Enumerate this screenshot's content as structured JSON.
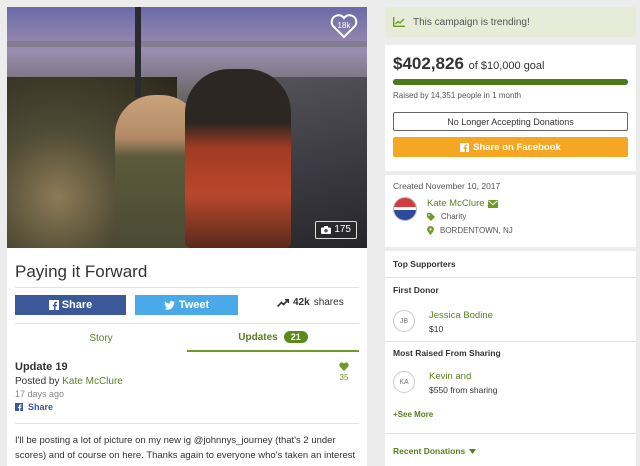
{
  "campaign": {
    "title": "Paying it Forward",
    "photo_count": "175",
    "like_count": "18k"
  },
  "share": {
    "facebook_label": "Share",
    "twitter_label": "Tweet",
    "shares_count": "42k",
    "shares_suffix": "shares"
  },
  "tabs": {
    "story_label": "Story",
    "updates_label": "Updates",
    "updates_count": "21"
  },
  "update": {
    "title": "Update 19",
    "posted_by_prefix": "Posted by",
    "author": "Kate McClure",
    "ago": "17 days ago",
    "share_label": "Share",
    "heart_count": "35",
    "text": "I'll be posting a lot of picture on my new ig @johnnys_journey (that's 2 under scores) and of course on here. Thanks again to everyone who's taken an interest in me!!"
  },
  "sidebar": {
    "trending_text": "This campaign is trending!",
    "raised_amount": "$402,826",
    "goal_text": "of $10,000 goal",
    "progress_fraction": 1.0,
    "raised_meta": "Raised by 14,351 people in 1 month",
    "no_longer_label": "No Longer Accepting Donations",
    "facebook_big_label": "Share on Facebook",
    "created": "Created November 10, 2017",
    "organizer_name": "Kate McClure",
    "organizer_type": "Charity",
    "organizer_location": "BORDENTOWN, NJ"
  },
  "supporters": {
    "heading": "Top Supporters",
    "first_donor_label": "First Donor",
    "first_donor": {
      "initials": "JB",
      "name": "Jessica Bodine",
      "amount": "$10"
    },
    "most_raised_label": "Most Raised From Sharing",
    "most_raised": {
      "initials": "KA",
      "name": "Kevin and",
      "amount": "$550 from sharing"
    },
    "see_more_label": "See More",
    "recent_label": "Recent Donations"
  },
  "colors": {
    "brand_green": "#5b7f1f",
    "facebook_blue": "#3b5998",
    "twitter_blue": "#4aa9e8",
    "orange_button": "#f5a623"
  }
}
